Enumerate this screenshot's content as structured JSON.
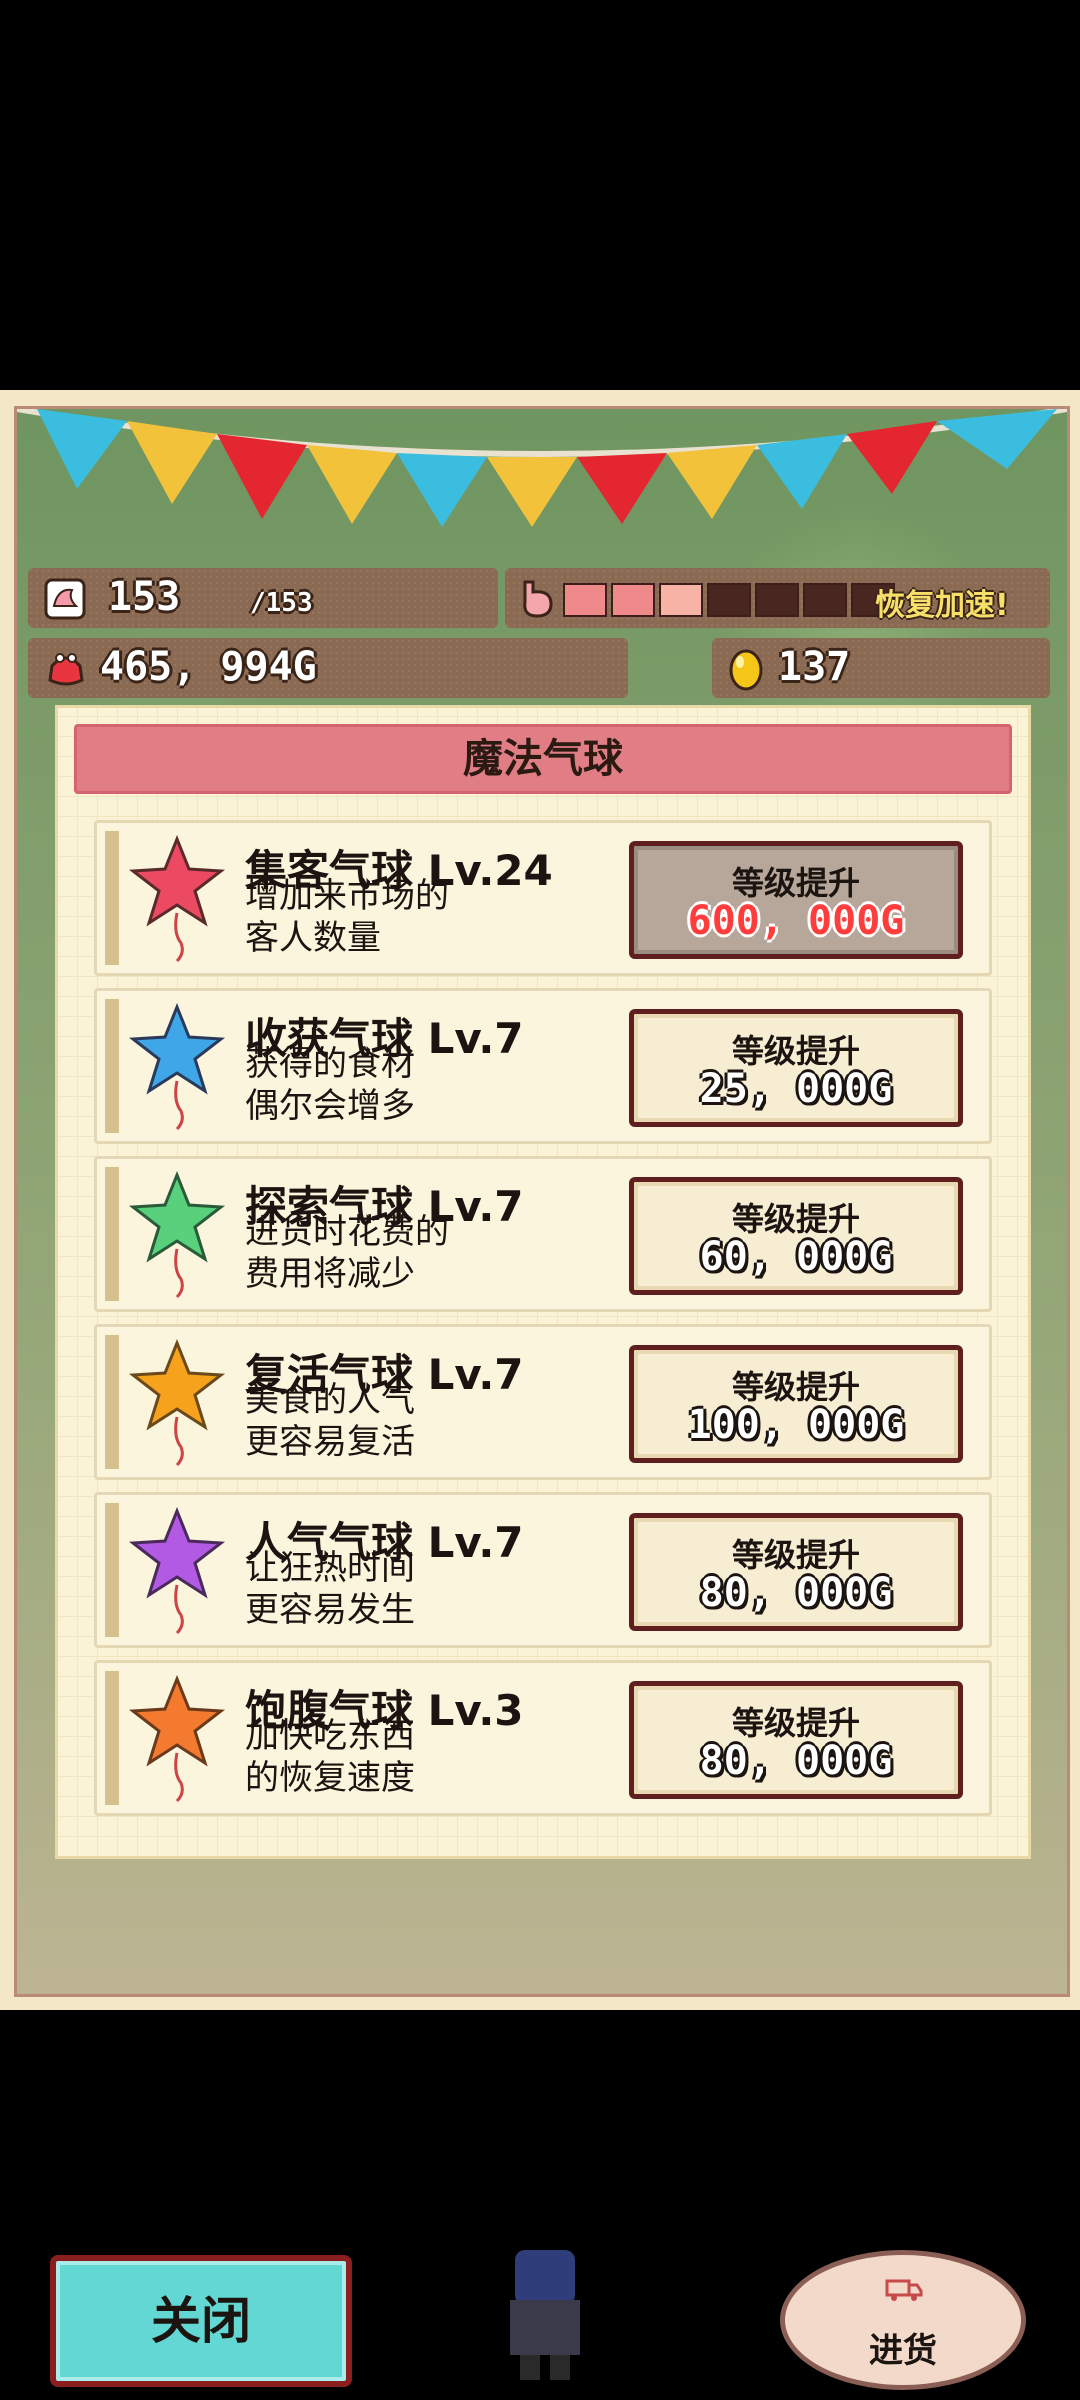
{
  "hud": {
    "stamina_current": "153",
    "stamina_max": "/153",
    "hunger_level": 0.38,
    "recovery_label": "恢复加速!",
    "gold": "465, 994G",
    "eggs": "137"
  },
  "panel": {
    "title": "魔法气球",
    "upgrade_label": "等级提升",
    "items": [
      {
        "title": "集客气球 Lv.24",
        "desc": "增加来市场的\n客人数量",
        "cost": "600, 000G",
        "color": "#ec4a63",
        "affordable": false
      },
      {
        "title": "收获气球 Lv.7",
        "desc": "获得的食材\n偶尔会增多",
        "cost": "25, 000G",
        "color": "#3fa6e8",
        "affordable": true
      },
      {
        "title": "探索气球 Lv.7",
        "desc": "进货时花费的\n费用将减少",
        "cost": "60, 000G",
        "color": "#58d07c",
        "affordable": true
      },
      {
        "title": "复活气球 Lv.7",
        "desc": "美食的人气\n更容易复活",
        "cost": "100, 000G",
        "color": "#f7a21c",
        "affordable": true
      },
      {
        "title": "人气气球 Lv.7",
        "desc": "让狂热时间\n更容易发生",
        "cost": "80, 000G",
        "color": "#b25ae4",
        "affordable": true
      },
      {
        "title": "饱腹气球 Lv.3",
        "desc": "加快吃东西\n的恢复速度",
        "cost": "80, 000G",
        "color": "#f47a30",
        "affordable": true
      }
    ]
  },
  "footer": {
    "close_label": "关闭",
    "stock_label": "进货"
  }
}
